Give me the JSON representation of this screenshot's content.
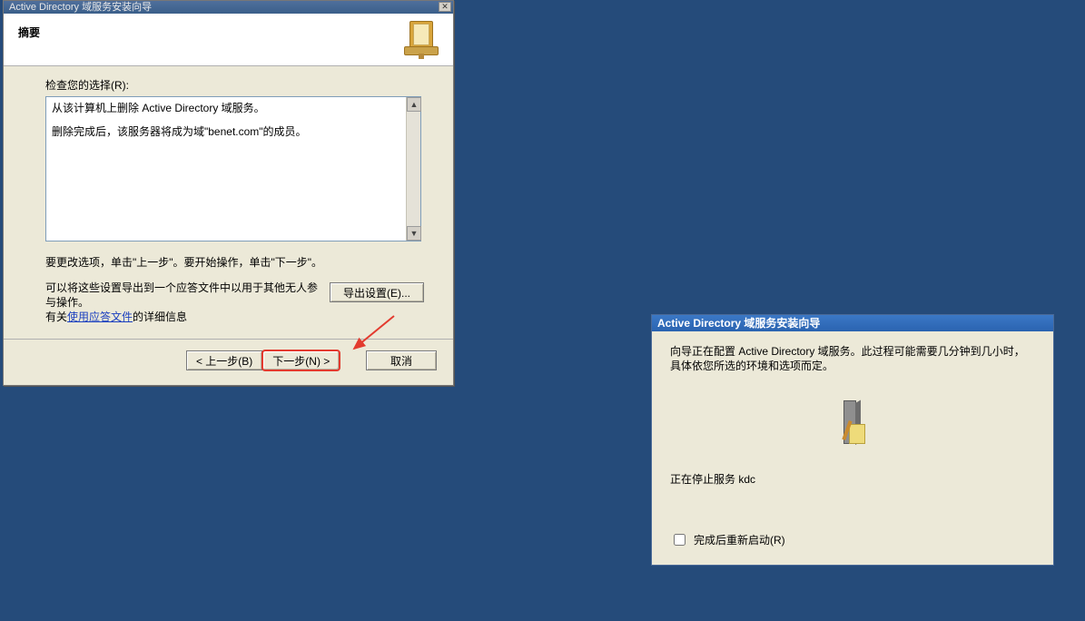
{
  "dlg1": {
    "titlebar": "Active Directory 域服务安装向导",
    "header_title": "摘要",
    "review_label": "检查您的选择(R):",
    "review_line1": "从该计算机上删除 Active Directory 域服务。",
    "review_line2": "删除完成后，该服务器将成为域\"benet.com\"的成员。",
    "instruction": "要更改选项，单击\"上一步\"。要开始操作，单击\"下一步\"。",
    "export_text1": "可以将这些设置导出到一个应答文件中以用于其他无人参与操作。",
    "export_text2_prefix": "有关",
    "export_link": "使用应答文件",
    "export_text2_suffix": "的详细信息",
    "export_button": "导出设置(E)...",
    "back_button": "< 上一步(B)",
    "next_button": "下一步(N) >",
    "cancel_button": "取消"
  },
  "dlg2": {
    "titlebar": "Active Directory 域服务安装向导",
    "desc": "向导正在配置 Active Directory 域服务。此过程可能需要几分钟到几小时，具体依您所选的环境和选项而定。",
    "status": "正在停止服务 kdc",
    "checkbox_label": "完成后重新启动(R)"
  }
}
